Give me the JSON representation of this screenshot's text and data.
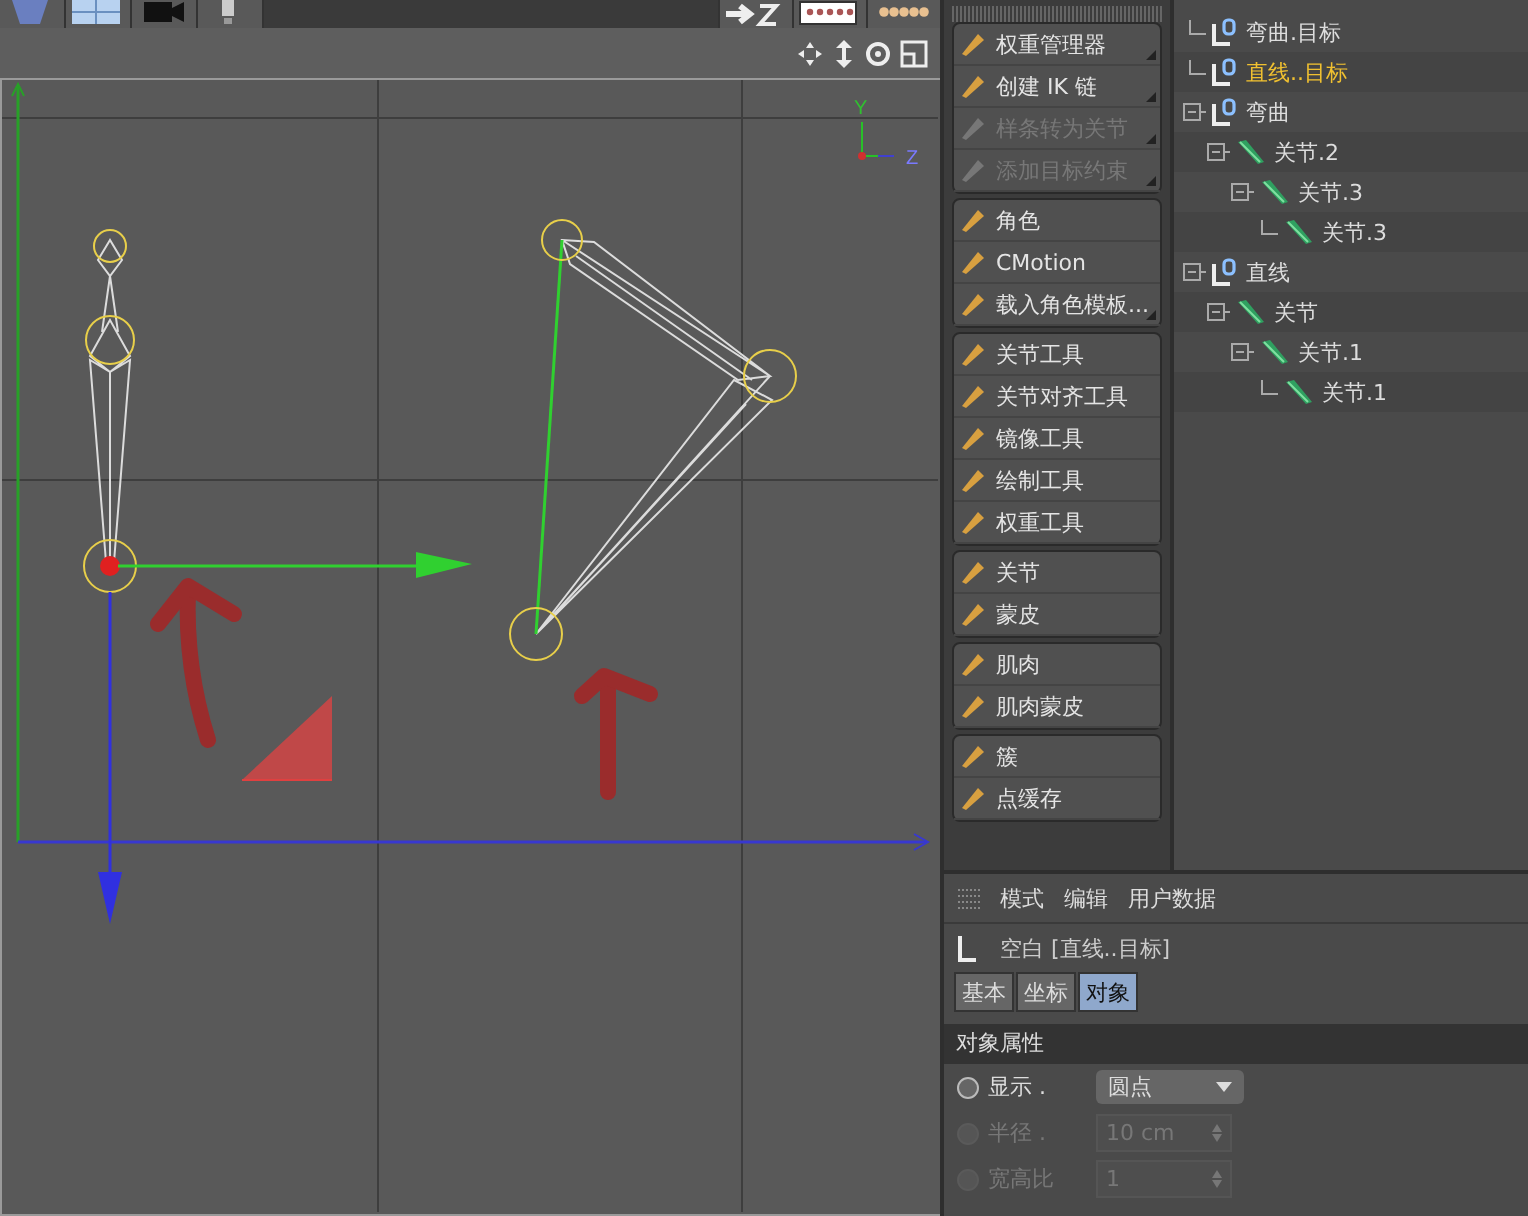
{
  "viewport": {
    "axis_labels": [
      {
        "text": "Y",
        "kind": "y"
      },
      {
        "text": "Z",
        "kind": "z"
      }
    ]
  },
  "palette": {
    "groups": [
      {
        "items": [
          {
            "label": "权重管理器",
            "disabled": false,
            "submenu": true
          },
          {
            "label": "创建 IK 链",
            "disabled": false,
            "submenu": true
          },
          {
            "label": "样条转为关节",
            "disabled": true,
            "submenu": true
          },
          {
            "label": "添加目标约束",
            "disabled": true,
            "submenu": true
          }
        ]
      },
      {
        "items": [
          {
            "label": "角色",
            "disabled": false,
            "submenu": false
          },
          {
            "label": "CMotion",
            "disabled": false,
            "submenu": false
          },
          {
            "label": "载入角色模板...",
            "disabled": false,
            "submenu": true
          }
        ]
      },
      {
        "items": [
          {
            "label": "关节工具",
            "disabled": false,
            "submenu": false
          },
          {
            "label": "关节对齐工具",
            "disabled": false,
            "submenu": false
          },
          {
            "label": "镜像工具",
            "disabled": false,
            "submenu": false
          },
          {
            "label": "绘制工具",
            "disabled": false,
            "submenu": false
          },
          {
            "label": "权重工具",
            "disabled": false,
            "submenu": false
          }
        ]
      },
      {
        "items": [
          {
            "label": "关节",
            "disabled": false,
            "submenu": false
          },
          {
            "label": "蒙皮",
            "disabled": false,
            "submenu": false
          }
        ]
      },
      {
        "items": [
          {
            "label": "肌肉",
            "disabled": false,
            "submenu": false
          },
          {
            "label": "肌肉蒙皮",
            "disabled": false,
            "submenu": false
          }
        ]
      },
      {
        "items": [
          {
            "label": "簇",
            "disabled": false,
            "submenu": false
          },
          {
            "label": "点缓存",
            "disabled": false,
            "submenu": false
          }
        ]
      }
    ]
  },
  "tree": {
    "items": [
      {
        "label": "弯曲.目标",
        "kind": "null",
        "selected": false,
        "expanded": false
      },
      {
        "label": "直线..目标",
        "kind": "null",
        "selected": true,
        "expanded": false
      },
      {
        "label": "弯曲",
        "kind": "null",
        "selected": false,
        "expanded": true,
        "children": [
          {
            "label": "关节.2",
            "kind": "joint",
            "selected": false,
            "expanded": true,
            "children": [
              {
                "label": "关节.3",
                "kind": "joint",
                "selected": false,
                "expanded": true,
                "children": [
                  {
                    "label": "关节.3",
                    "kind": "joint",
                    "selected": false,
                    "expanded": false
                  }
                ]
              }
            ]
          }
        ]
      },
      {
        "label": "直线",
        "kind": "null",
        "selected": false,
        "expanded": true,
        "children": [
          {
            "label": "关节",
            "kind": "joint",
            "selected": false,
            "expanded": true,
            "children": [
              {
                "label": "关节.1",
                "kind": "joint",
                "selected": false,
                "expanded": true,
                "children": [
                  {
                    "label": "关节.1",
                    "kind": "joint",
                    "selected": false,
                    "expanded": false
                  }
                ]
              }
            ]
          }
        ]
      }
    ]
  },
  "attributes": {
    "menu": [
      "模式",
      "编辑",
      "用户数据"
    ],
    "object_title": "空白 [直线..目标]",
    "tabs": [
      {
        "label": "基本",
        "selected": false
      },
      {
        "label": "坐标",
        "selected": false
      },
      {
        "label": "对象",
        "selected": true
      }
    ],
    "section": "对象属性",
    "fields": [
      {
        "label": "显示 .",
        "value": "圆点",
        "kind": "dropdown",
        "disabled": false
      },
      {
        "label": "半径 .",
        "value": "10 cm",
        "kind": "number",
        "disabled": true
      },
      {
        "label": "宽高比",
        "value": "1",
        "kind": "number",
        "disabled": true
      }
    ]
  }
}
